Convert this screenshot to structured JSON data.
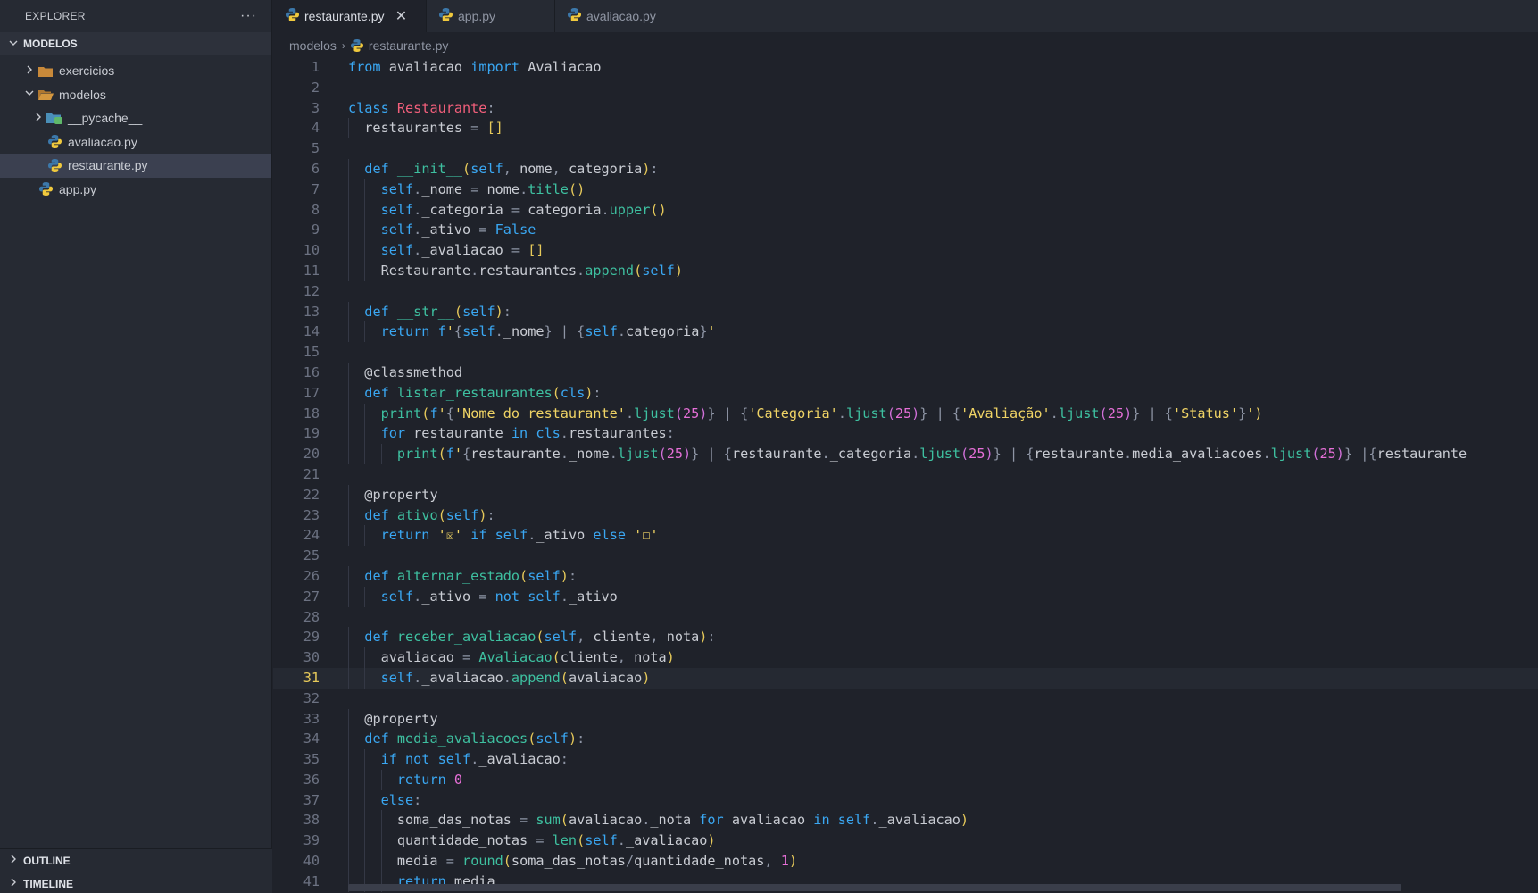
{
  "explorer": {
    "title": "EXPLORER",
    "more_label": "···",
    "section": "MODELOS",
    "tree": [
      {
        "label": "exercicios",
        "kind": "folder",
        "expanded": false
      },
      {
        "label": "modelos",
        "kind": "folder-open",
        "expanded": true
      },
      {
        "label": "__pycache__",
        "kind": "pycache",
        "expanded": false
      },
      {
        "label": "avaliacao.py",
        "kind": "python"
      },
      {
        "label": "restaurante.py",
        "kind": "python",
        "active": true
      },
      {
        "label": "app.py",
        "kind": "python"
      }
    ],
    "outline": "OUTLINE",
    "timeline": "TIMELINE"
  },
  "tabs": [
    {
      "label": "restaurante.py",
      "active": true,
      "close": "✕"
    },
    {
      "label": "app.py",
      "active": false
    },
    {
      "label": "avaliacao.py",
      "active": false
    }
  ],
  "breadcrumb": {
    "folder": "modelos",
    "separator": "›",
    "file": "restaurante.py"
  },
  "code": {
    "cursor_line": 31,
    "lines": [
      "from avaliacao import Avaliacao",
      "",
      "class Restaurante:",
      "  restaurantes = []",
      "",
      "  def __init__(self, nome, categoria):",
      "    self._nome = nome.title()",
      "    self._categoria = categoria.upper()",
      "    self._ativo = False",
      "    self._avaliacao = []",
      "    Restaurante.restaurantes.append(self)",
      "",
      "  def __str__(self):",
      "    return f'{self._nome} | {self.categoria}'",
      "",
      "  @classmethod",
      "  def listar_restaurantes(cls):",
      "    print(f'{'Nome do restaurante'.ljust(25)} | {'Categoria'.ljust(25)} | {'Avaliação'.ljust(25)} | {'Status'}')",
      "    for restaurante in cls.restaurantes:",
      "      print(f'{restaurante._nome.ljust(25)} | {restaurante._categoria.ljust(25)} | {restaurante.media_avaliacoes.ljust(25)} |{restaurante",
      "",
      "  @property",
      "  def ativo(self):",
      "    return '☒' if self._ativo else '☐'",
      "",
      "  def alternar_estado(self):",
      "    self._ativo = not self._ativo",
      "",
      "  def receber_avaliacao(self, cliente, nota):",
      "    avaliacao = Avaliacao(cliente, nota)",
      "    self._avaliacao.append(avaliacao)",
      "",
      "  @property",
      "  def media_avaliacoes(self):",
      "    if not self._avaliacao:",
      "      return 0",
      "    else:",
      "      soma_das_notas = sum(avaliacao._nota for avaliacao in self._avaliacao)",
      "      quantidade_notas = len(self._avaliacao)",
      "      media = round(soma_das_notas/quantidade_notas, 1)",
      "      return media"
    ]
  },
  "colors": {
    "keyword": "#3aa7f2",
    "class_name": "#f25f7b",
    "function": "#3ec0a0",
    "string": "#f0d465",
    "number": "#e66fd7",
    "background": "#1f222a",
    "sidebar": "#262a33"
  }
}
